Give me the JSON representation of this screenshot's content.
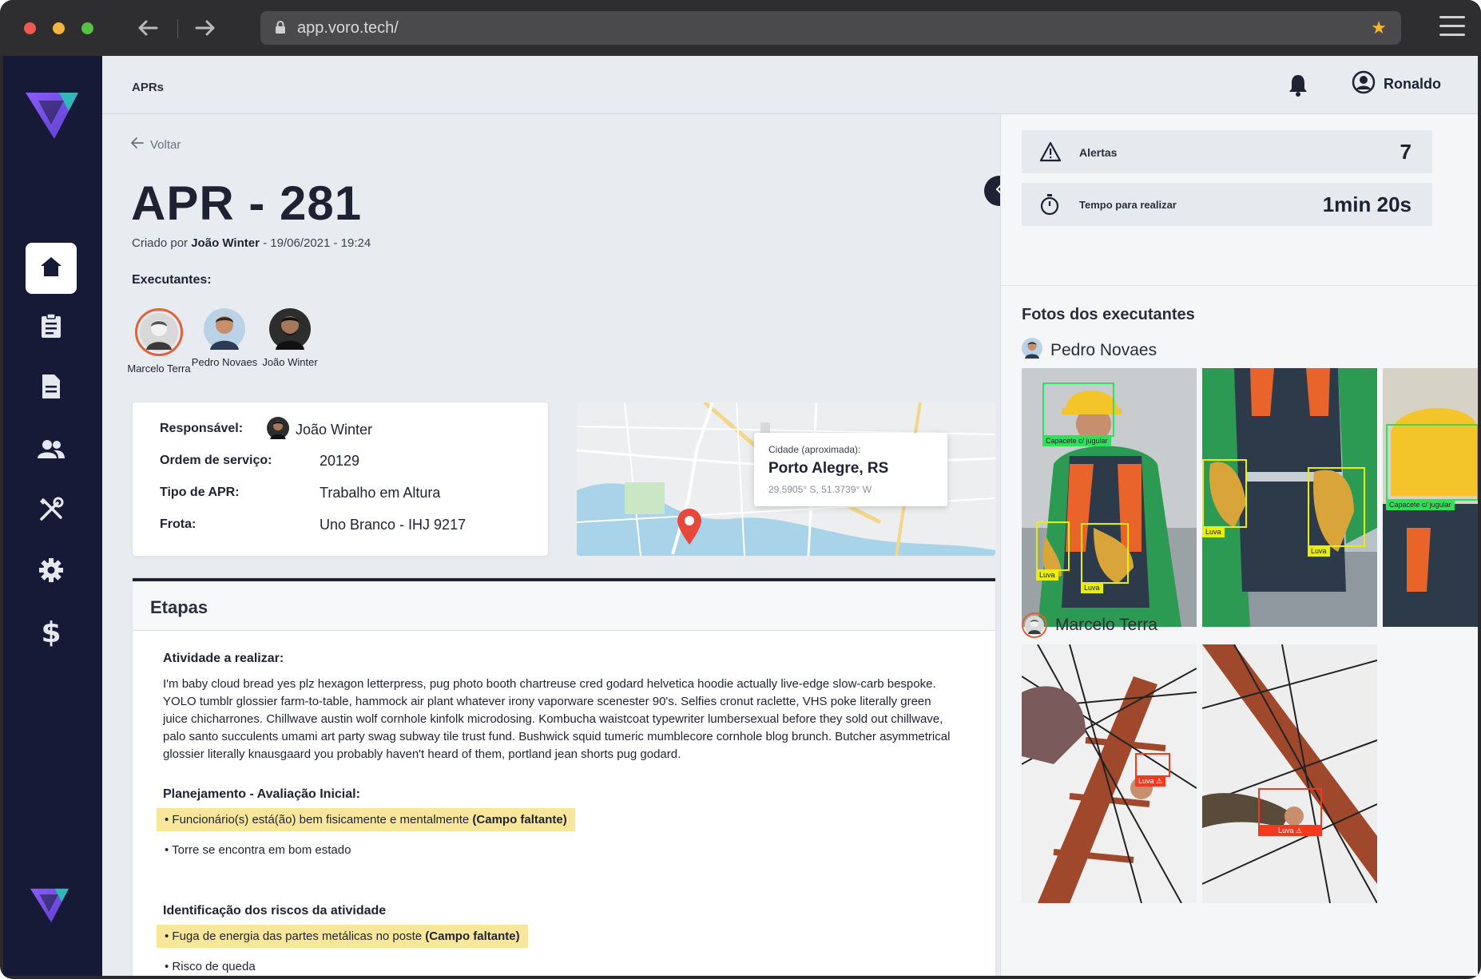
{
  "browser": {
    "url": "app.voro.tech/"
  },
  "header": {
    "breadcrumb": "APRs",
    "user_name": "Ronaldo"
  },
  "apr": {
    "back_label": "Voltar",
    "title": "APR - 281",
    "created_prefix": "Criado por",
    "created_by": "João Winter",
    "created_at": "- 19/06/2021 - 19:24",
    "executors_label": "Executantes:",
    "executors": [
      {
        "name": "Marcelo Terra"
      },
      {
        "name": "Pedro Novaes"
      },
      {
        "name": "João Winter"
      }
    ]
  },
  "info": {
    "responsavel_label": "Responsável:",
    "responsavel_value": "João Winter",
    "ordem_label": "Ordem de serviço:",
    "ordem_value": "20129",
    "tipo_label": "Tipo de APR:",
    "tipo_value": "Trabalho em Altura",
    "frota_label": "Frota:",
    "frota_value": "Uno Branco - IHJ 9217"
  },
  "map": {
    "city_label": "Cidade (aproximada):",
    "city": "Porto Alegre, RS",
    "coords": "29.5905° S, 51.3739° W"
  },
  "steps": {
    "title": "Etapas",
    "activity_title": "Atividade a realizar:",
    "activity_text": "I'm baby cloud bread yes plz hexagon letterpress, pug photo booth chartreuse cred godard helvetica hoodie actually live-edge slow-carb bespoke. YOLO tumblr glossier farm-to-table, hammock air plant whatever irony vaporware scenester 90's. Selfies cronut raclette, VHS poke literally green juice chicharrones. Chillwave austin wolf cornhole kinfolk microdosing. Kombucha waistcoat typewriter lumbersexual before they sold out chillwave, palo santo succulents umami art party swag subway tile trust fund. Bushwick squid tumeric mumblecore cornhole blog brunch. Butcher asymmetrical glossier literally knausgaard you probably haven't heard of them, portland jean shorts pug godard.",
    "planning_title": "Planejamento - Avaliação Inicial:",
    "planning_item1": "• Funcionário(s) está(ão) bem fisicamente e mentalmente",
    "missing_tag": "(Campo faltante)",
    "planning_item2": "• Torre se encontra em bom estado",
    "risks_title": "Identificação dos riscos da atividade",
    "risks_item1": "• Fuga de energia das partes metálicas no poste",
    "risks_item2": "• Risco de queda"
  },
  "stats": {
    "alerts_label": "Alertas",
    "alerts_value": "7",
    "time_label": "Tempo para realizar",
    "time_value": "1min 20s"
  },
  "photos": {
    "title": "Fotos dos executantes",
    "person1": "Pedro Novaes",
    "person2": "Marcelo Terra",
    "tag_helmet": "Capacete c/ jugular",
    "tag_glove": "Luva",
    "tag_helmet_cut": "Capacete c/ jugular"
  },
  "colors": {
    "sidebar": "#171a37",
    "accent_red": "#e0613b",
    "warning_highlight": "#f8e79a",
    "detect_yellow": "#e8f000",
    "detect_green": "#2ee05a",
    "detect_red": "#f33a1d"
  }
}
